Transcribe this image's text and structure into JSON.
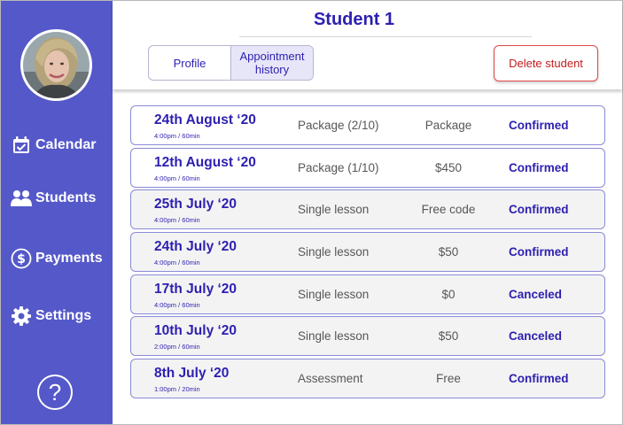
{
  "header": {
    "title": "Student 1",
    "tabs": [
      {
        "label": "Profile",
        "active": false
      },
      {
        "label": "Appointment history",
        "active": true
      }
    ],
    "delete_label": "Delete student"
  },
  "sidebar": {
    "items": [
      {
        "label": "Calendar",
        "icon": "calendar-icon"
      },
      {
        "label": "Students",
        "icon": "students-icon"
      },
      {
        "label": "Payments",
        "icon": "dollar-icon"
      },
      {
        "label": "Settings",
        "icon": "gear-icon"
      }
    ],
    "help_label": "?"
  },
  "colors": {
    "sidebar": "#5558c8",
    "accent": "#2d1fb0",
    "delete": "#c01d1d"
  },
  "appointments": [
    {
      "date": "24th August ‘20",
      "time": "4:00pm / 60min",
      "type": "Package (2/10)",
      "price": "Package",
      "status": "Confirmed"
    },
    {
      "date": "12th August ‘20",
      "time": "4:00pm / 60min",
      "type": "Package (1/10)",
      "price": "$450",
      "status": "Confirmed"
    },
    {
      "date": "25th July ‘20",
      "time": "4:00pm / 60min",
      "type": "Single lesson",
      "price": "Free code",
      "status": "Confirmed"
    },
    {
      "date": "24th July ‘20",
      "time": "4:00pm / 60min",
      "type": "Single lesson",
      "price": "$50",
      "status": "Confirmed"
    },
    {
      "date": "17th July ‘20",
      "time": "4:00pm / 60min",
      "type": "Single lesson",
      "price": "$0",
      "status": "Canceled"
    },
    {
      "date": "10th July ‘20",
      "time": "2:00pm / 60min",
      "type": "Single lesson",
      "price": "$50",
      "status": "Canceled"
    },
    {
      "date": "8th July ‘20",
      "time": "1:00pm / 20min",
      "type": "Assessment",
      "price": "Free",
      "status": "Confirmed"
    }
  ]
}
